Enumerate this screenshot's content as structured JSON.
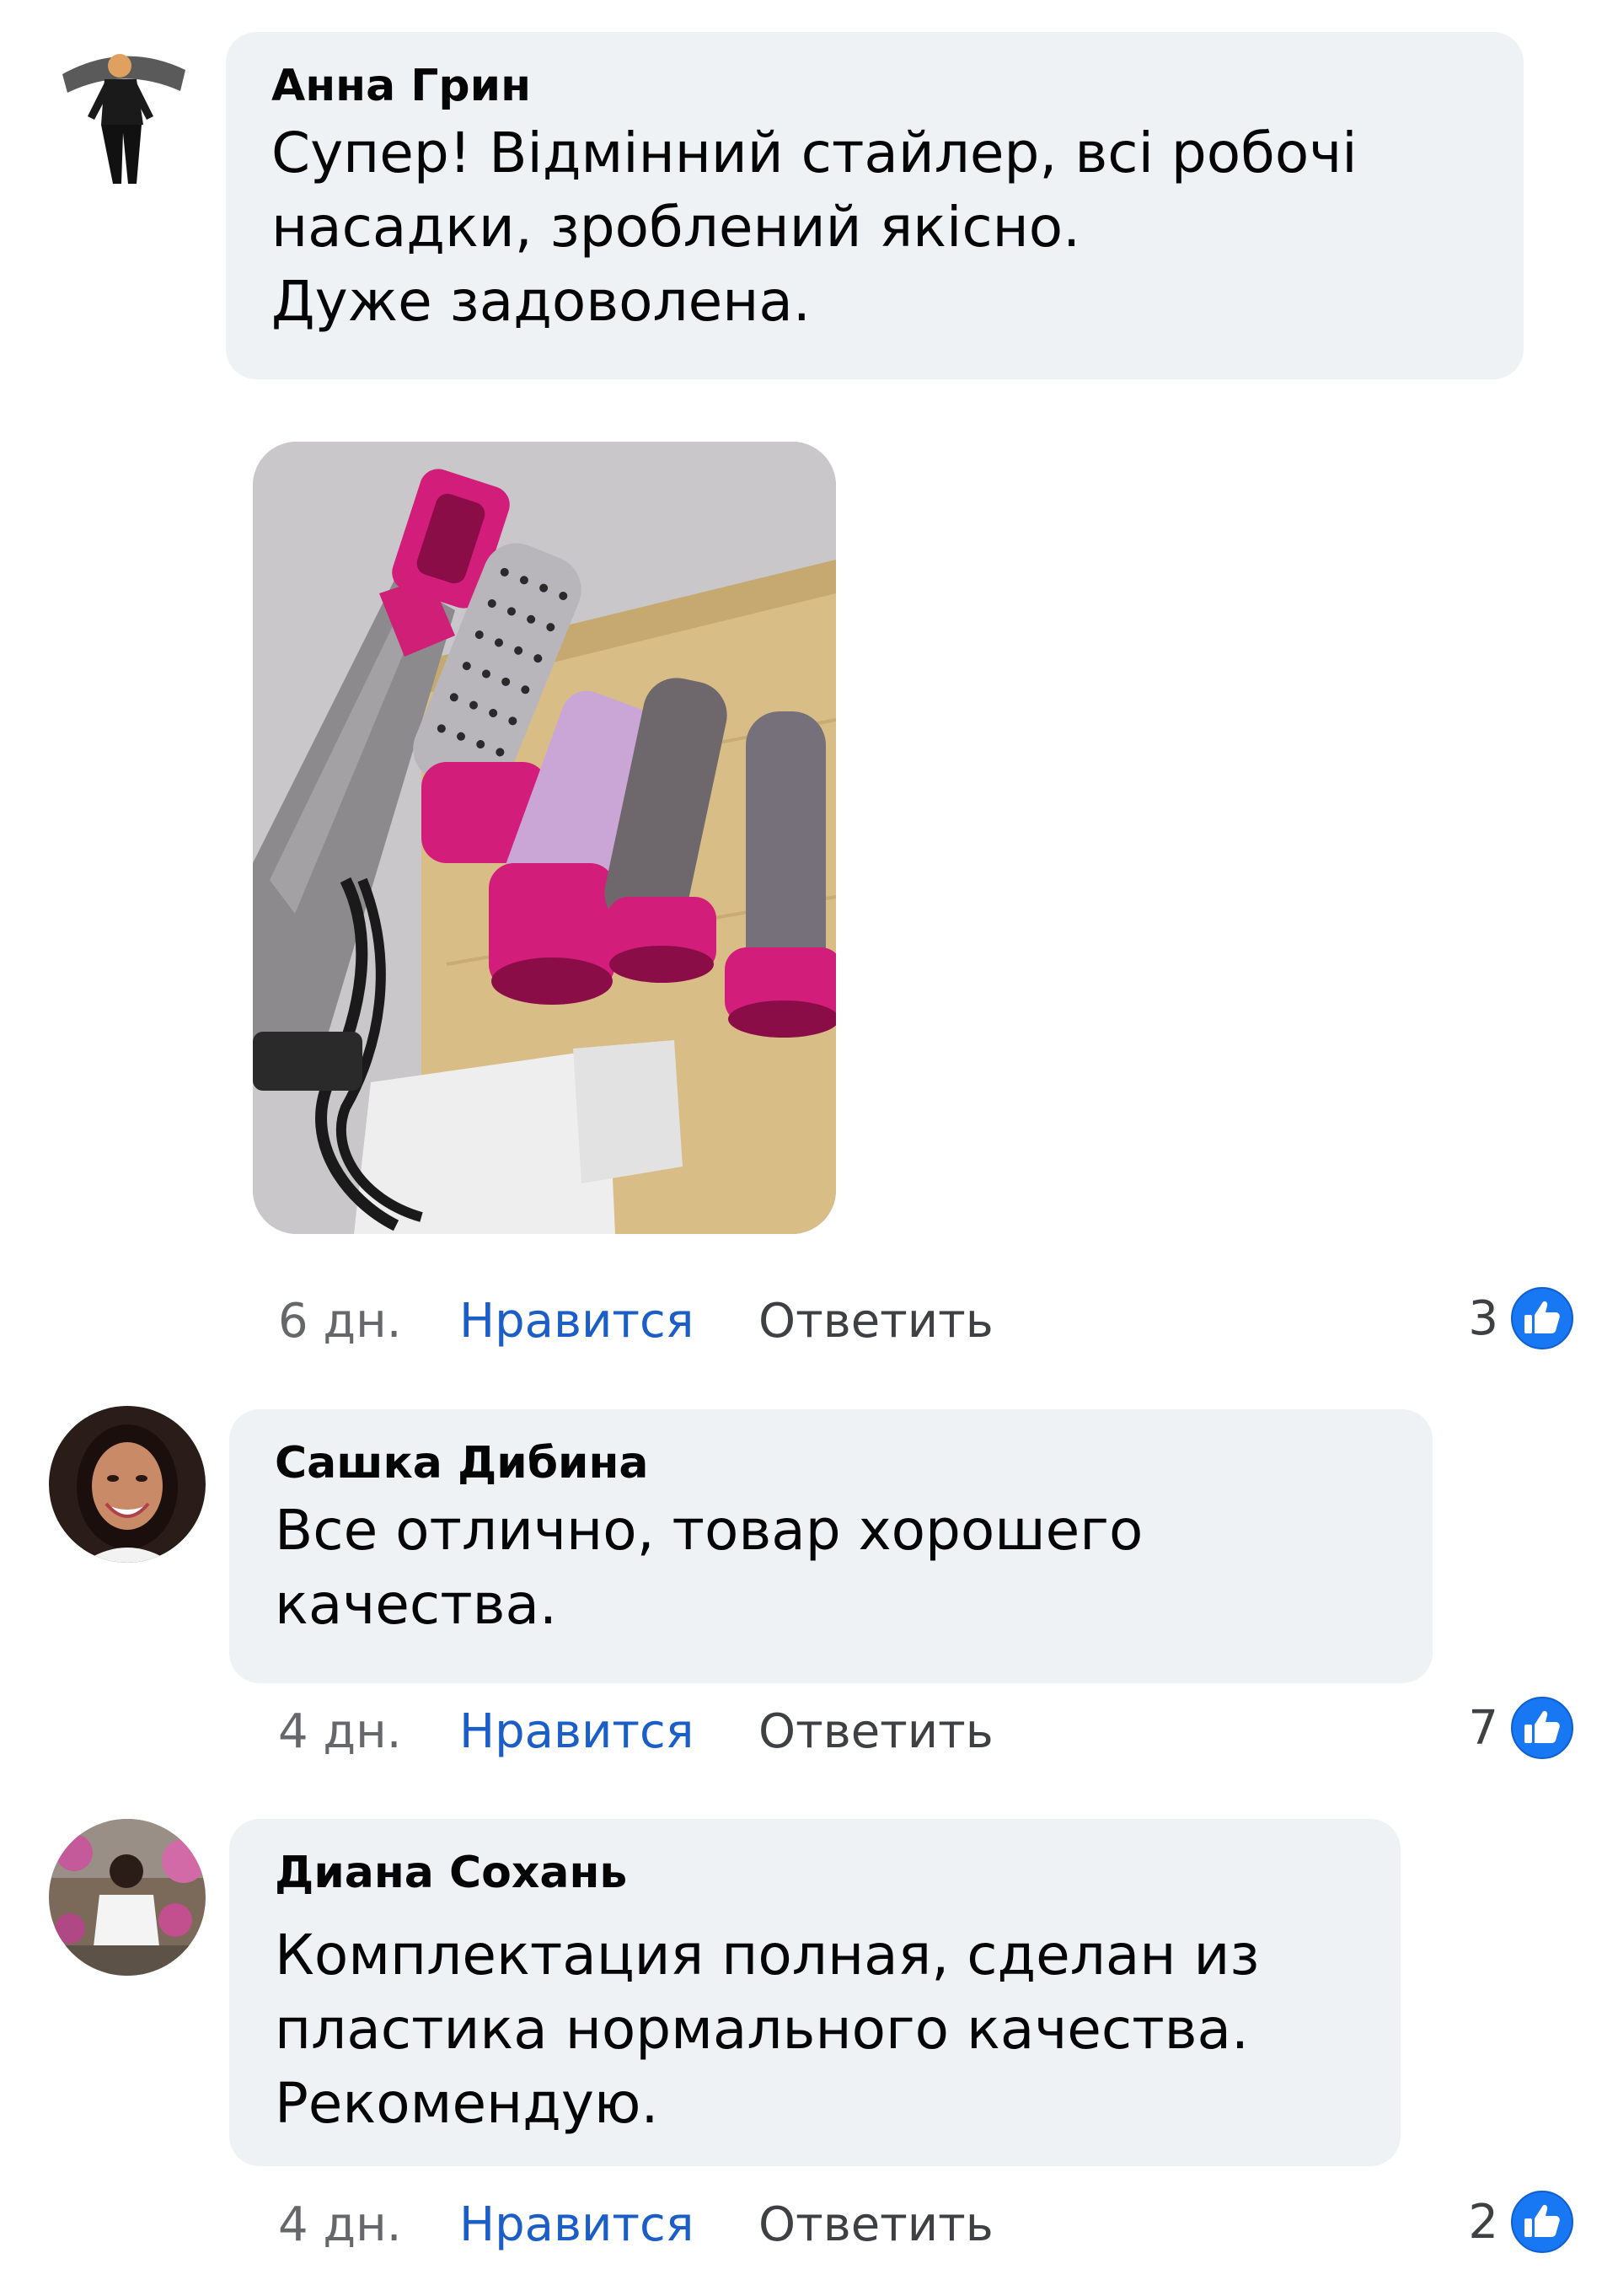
{
  "comments": [
    {
      "author": "Анна Грин",
      "text_lines": [
        "Супер! Відмінний стайлер, всі робочі",
        "насадки, зроблений якісно.",
        "Дуже задоволена."
      ],
      "time": "6 дн.",
      "like_label": "Нравится",
      "reply_label": "Ответить",
      "likes": "3",
      "attachment": "photo of a pink and grey hair styler with brush attachments"
    },
    {
      "author": "Сашка Дибина",
      "text_lines": [
        "Все отлично, товар хорошего",
        "качества."
      ],
      "time": "4 дн.",
      "like_label": "Нравится",
      "reply_label": "Ответить",
      "likes": "7"
    },
    {
      "author": "Диана Сохань",
      "text_lines": [
        "Комплектация полная, сделан из",
        "пластика нормального качества.",
        "Рекомендую."
      ],
      "time": "4 дн.",
      "like_label": "Нравится",
      "reply_label": "Ответить",
      "likes": "2"
    }
  ],
  "colors": {
    "bubble": "#eff2f5",
    "like_link": "#1b5ec7",
    "like_icon": "#1877f2",
    "meta_text": "#65676b"
  },
  "icons": {
    "reaction": "thumbs-up-icon"
  }
}
